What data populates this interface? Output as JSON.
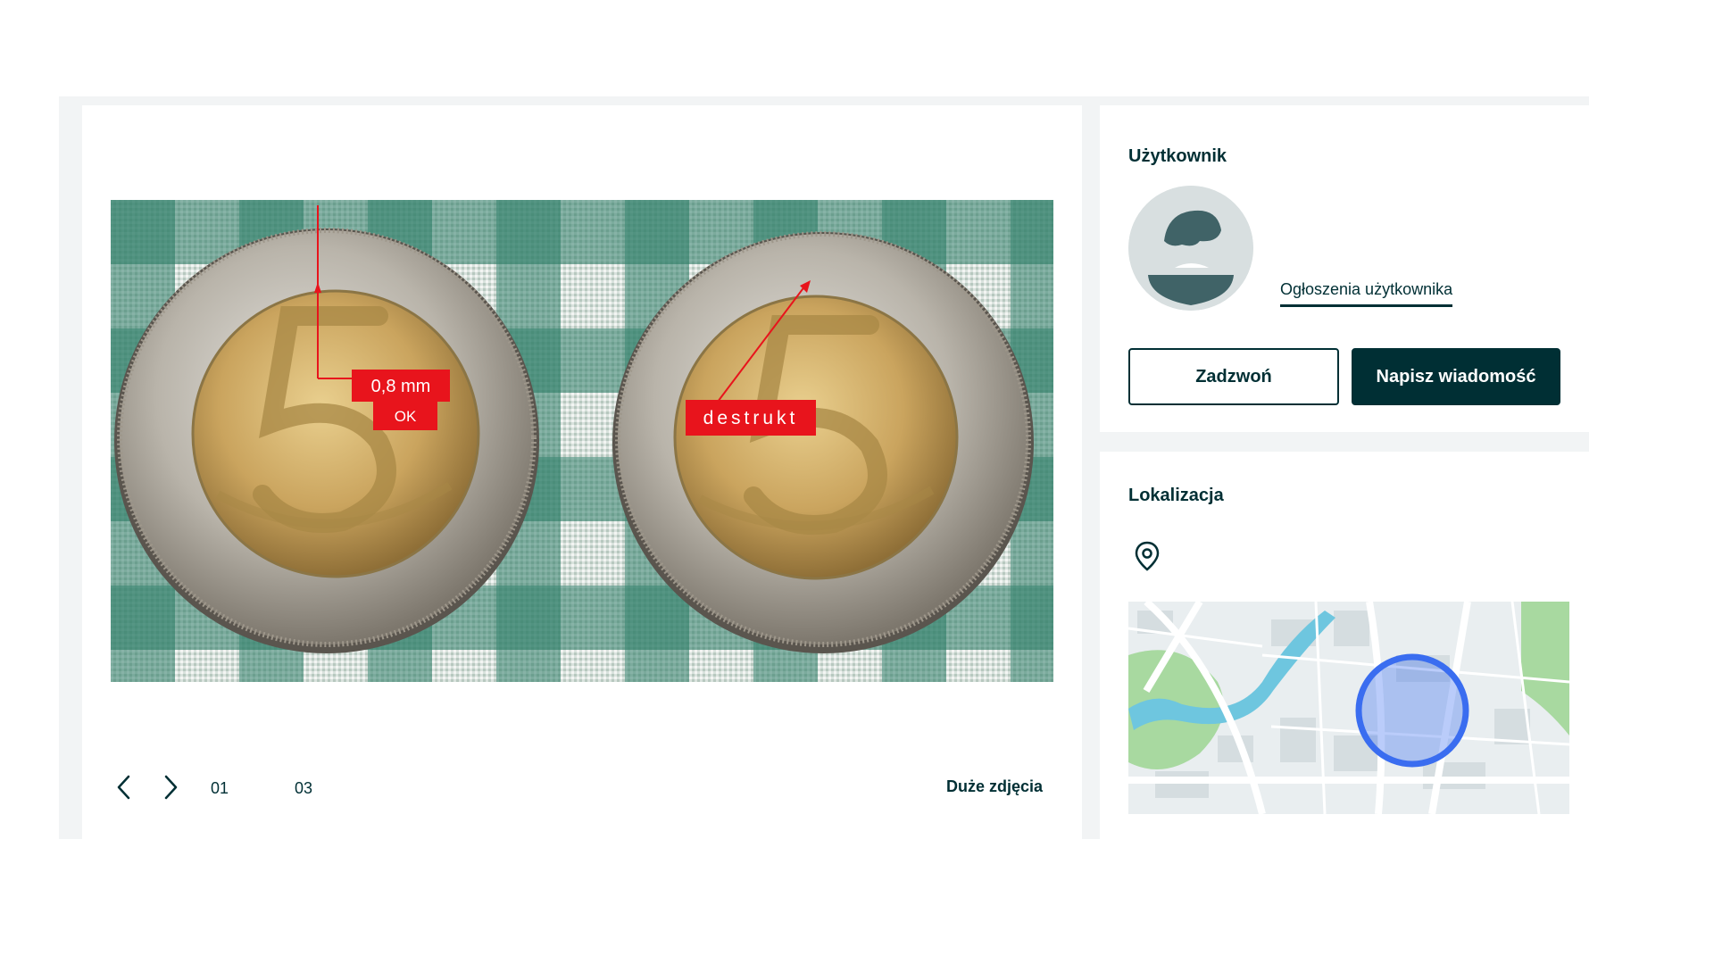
{
  "gallery": {
    "annotations": {
      "measure_value": "0,8 mm",
      "measure_status": "OK",
      "defect_label": "destrukt"
    },
    "current_index": "01",
    "total_count": "03",
    "large_photos_label": "Duże zdjęcia",
    "icons": [
      "chevron-left-icon",
      "chevron-right-icon"
    ]
  },
  "user_section": {
    "title": "Użytkownik",
    "user_ads_link": "Ogłoszenia użytkownika",
    "call_button": "Zadzwoń",
    "message_button": "Napisz wiadomość"
  },
  "location_section": {
    "title": "Lokalizacja",
    "icons": [
      "location-pin-icon"
    ]
  },
  "colors": {
    "primary": "#002f34",
    "annotation_red": "#e8141c",
    "map_circle": "#3a6df0"
  }
}
